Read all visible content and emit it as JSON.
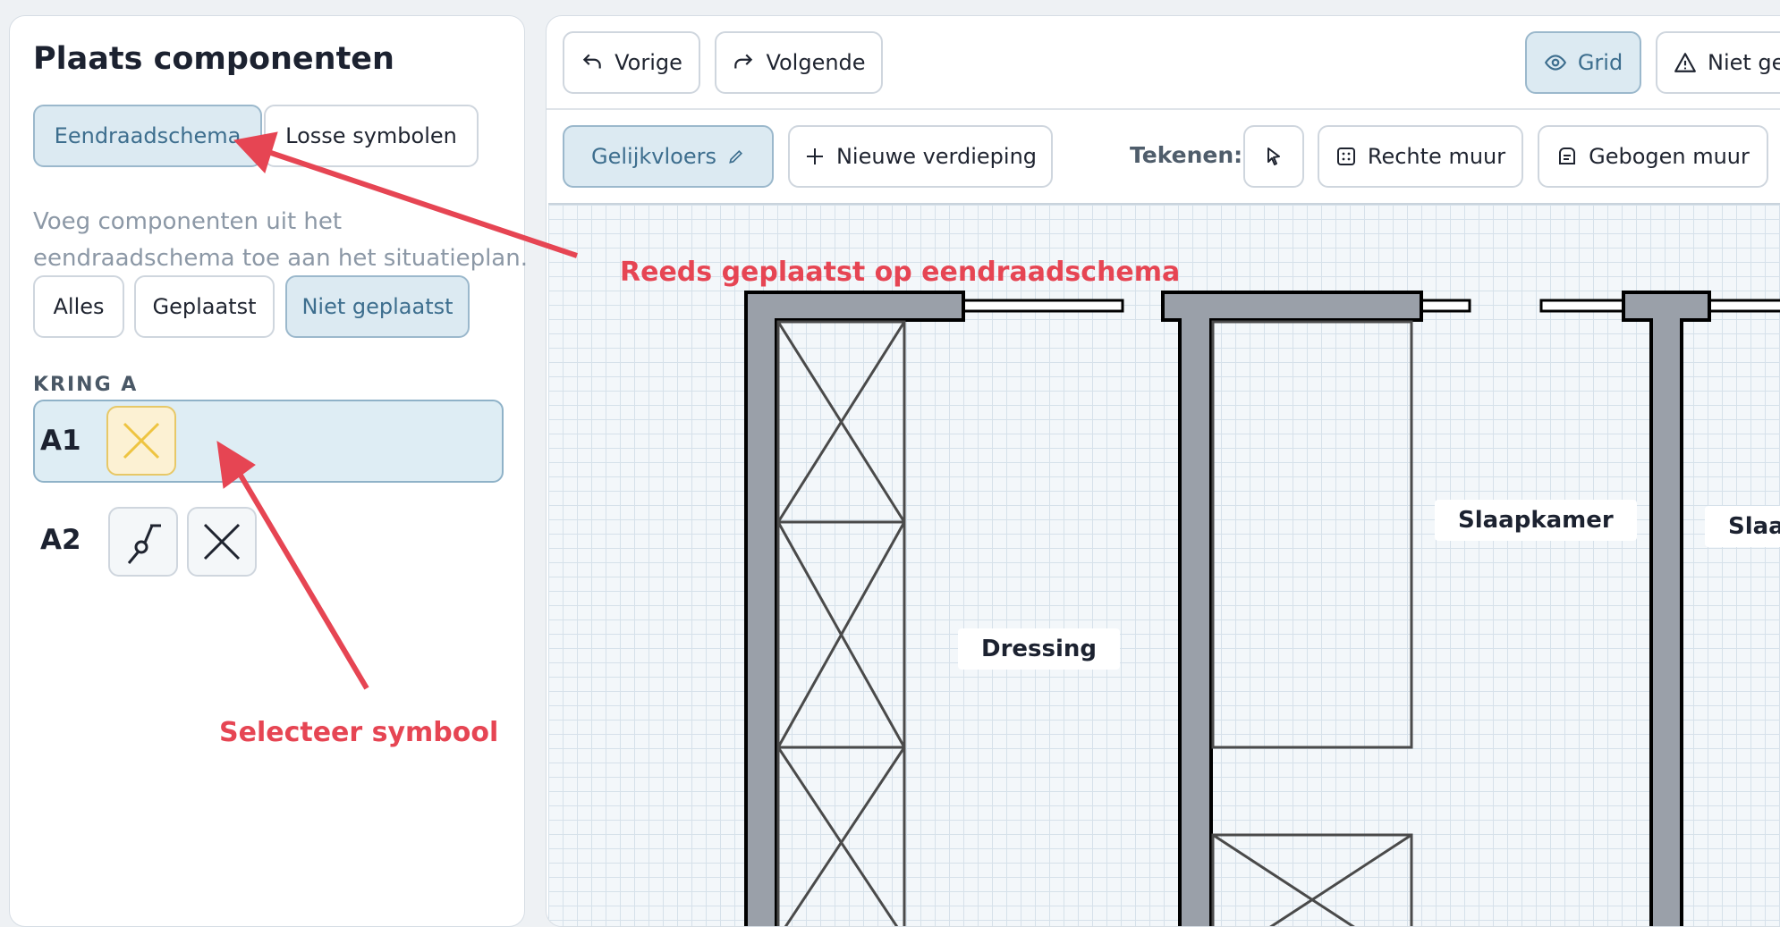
{
  "sidebar": {
    "title": "Plaats componenten",
    "tabs": [
      {
        "label": "Eendraadschema",
        "active": true
      },
      {
        "label": "Losse symbolen",
        "active": false
      }
    ],
    "description": "Voeg componenten uit het eendraadschema toe aan het situatieplan.",
    "filters": [
      {
        "label": "Alles",
        "active": false
      },
      {
        "label": "Geplaatst",
        "active": false
      },
      {
        "label": "Niet geplaatst",
        "active": true
      }
    ],
    "section_label": "KRING A",
    "circuits": [
      {
        "label": "A1",
        "symbols": [
          "cross-lamp-icon"
        ],
        "selected": true
      },
      {
        "label": "A2",
        "symbols": [
          "switch-icon",
          "cross-lamp-icon"
        ],
        "selected": false
      }
    ]
  },
  "toolbar": {
    "undo_label": "Vorige",
    "redo_label": "Volgende",
    "grid_label": "Grid",
    "warning_label": "Niet ge"
  },
  "floorbar": {
    "floor_label": "Gelijkvloers",
    "new_floor_label": "Nieuwe verdieping",
    "draw_label": "Tekenen:",
    "straight_wall_label": "Rechte muur",
    "curved_wall_label": "Gebogen muur"
  },
  "plan": {
    "rooms": [
      "Dressing",
      "Slaapkamer",
      "Slaa"
    ]
  },
  "annotations": {
    "placed": "Reeds geplaatst op eendraadschema",
    "select": "Selecteer symbool"
  },
  "colors": {
    "accent": "#3d6e8e",
    "accent_bg": "#dceaf2",
    "annotation": "#e64553",
    "wall": "#9aa0a9"
  }
}
